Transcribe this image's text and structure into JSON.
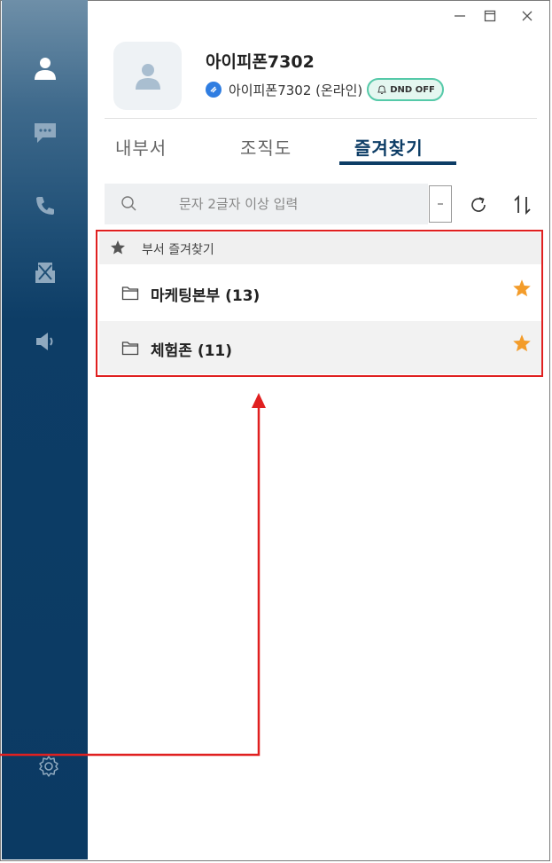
{
  "window": {
    "controls": {
      "minimize": "—",
      "maximize": "▢",
      "close": "✕"
    }
  },
  "sidebar": {
    "items": [
      {
        "name": "contacts",
        "icon": "person-icon"
      },
      {
        "name": "chat",
        "icon": "chat-bubble-icon"
      },
      {
        "name": "call",
        "icon": "phone-icon"
      },
      {
        "name": "fax",
        "icon": "fax-icon"
      },
      {
        "name": "broadcast",
        "icon": "speaker-icon"
      }
    ],
    "settings_icon": "gear-icon"
  },
  "profile": {
    "name": "아이피폰7302",
    "status_text": "아이피폰7302 (온라인)",
    "dnd_label": "DND OFF"
  },
  "tabs": [
    {
      "label": "내부서"
    },
    {
      "label": "조직도"
    },
    {
      "label": "즐겨찾기",
      "active": true
    }
  ],
  "search": {
    "placeholder": "문자 2글자 이상 입력"
  },
  "favorites": {
    "header_label": "부서 즐겨찾기",
    "rows": [
      {
        "label": "마케팅본부 (13)",
        "starred": true
      },
      {
        "label": "체험존 (11)",
        "starred": true
      }
    ]
  },
  "colors": {
    "sidebar": "#0b3a63",
    "accent": "#0d3d66",
    "star": "#f39c2a",
    "annotation": "#e02020",
    "dnd_border": "#55c9a8",
    "status_dot": "#2f7de1"
  }
}
